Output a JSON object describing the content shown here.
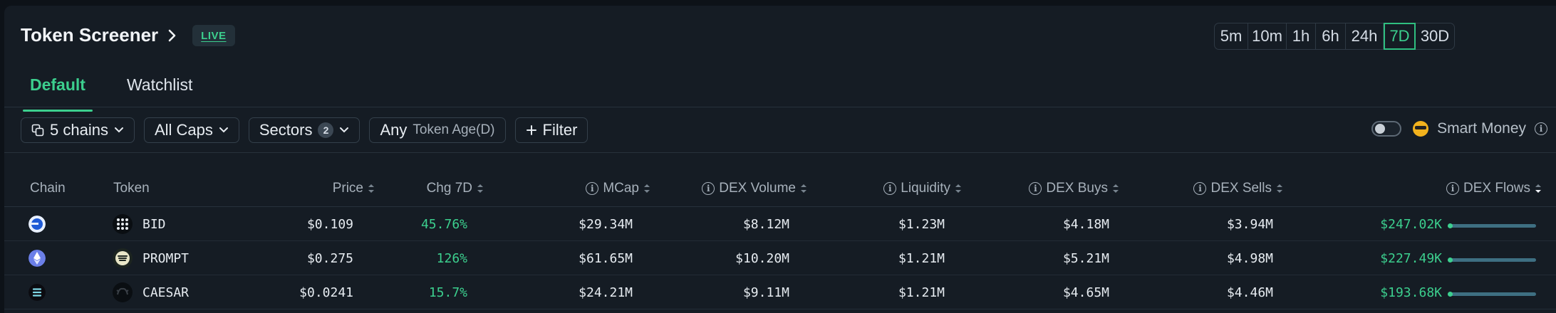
{
  "header": {
    "title": "Token Screener",
    "live_badge": "LIVE"
  },
  "timeframes": [
    {
      "label": "5m",
      "active": false
    },
    {
      "label": "10m",
      "active": false
    },
    {
      "label": "1h",
      "active": false
    },
    {
      "label": "6h",
      "active": false
    },
    {
      "label": "24h",
      "active": false
    },
    {
      "label": "7D",
      "active": true
    },
    {
      "label": "30D",
      "active": false
    }
  ],
  "tabs": [
    {
      "label": "Default",
      "active": true
    },
    {
      "label": "Watchlist",
      "active": false
    }
  ],
  "filters": {
    "chains_label": "5 chains",
    "caps_label": "All Caps",
    "sectors_label": "Sectors",
    "sectors_count": "2",
    "age_value": "Any",
    "age_label": "Token Age(D)",
    "filter_label": "Filter",
    "smart_money_label": "Smart Money",
    "smart_money_enabled": false
  },
  "table": {
    "columns": {
      "chain": "Chain",
      "token": "Token",
      "price": "Price",
      "chg": "Chg 7D",
      "mcap": "MCap",
      "dex_volume": "DEX Volume",
      "liquidity": "Liquidity",
      "dex_buys": "DEX Buys",
      "dex_sells": "DEX Sells",
      "dex_flows": "DEX Flows"
    },
    "rows": [
      {
        "chain_icon": "base-chain-icon",
        "token_icon": "bid-token-icon",
        "token": "BID",
        "price": "$0.109",
        "chg": "45.76%",
        "mcap": "$29.34M",
        "dex_volume": "$8.12M",
        "liquidity": "$1.23M",
        "dex_buys": "$4.18M",
        "dex_sells": "$3.94M",
        "dex_flows": "$247.02K"
      },
      {
        "chain_icon": "ethereum-chain-icon",
        "token_icon": "prompt-token-icon",
        "token": "PROMPT",
        "price": "$0.275",
        "chg": "126%",
        "mcap": "$61.65M",
        "dex_volume": "$10.20M",
        "liquidity": "$1.21M",
        "dex_buys": "$5.21M",
        "dex_sells": "$4.98M",
        "dex_flows": "$227.49K"
      },
      {
        "chain_icon": "solana-chain-icon",
        "token_icon": "caesar-token-icon",
        "token": "CAESAR",
        "price": "$0.0241",
        "chg": "15.7%",
        "mcap": "$24.21M",
        "dex_volume": "$9.11M",
        "liquidity": "$1.21M",
        "dex_buys": "$4.65M",
        "dex_sells": "$4.46M",
        "dex_flows": "$193.68K"
      }
    ]
  },
  "colors": {
    "accent": "#3ccf8e",
    "background": "#151c24",
    "flow_bar": "#3e6f82"
  }
}
